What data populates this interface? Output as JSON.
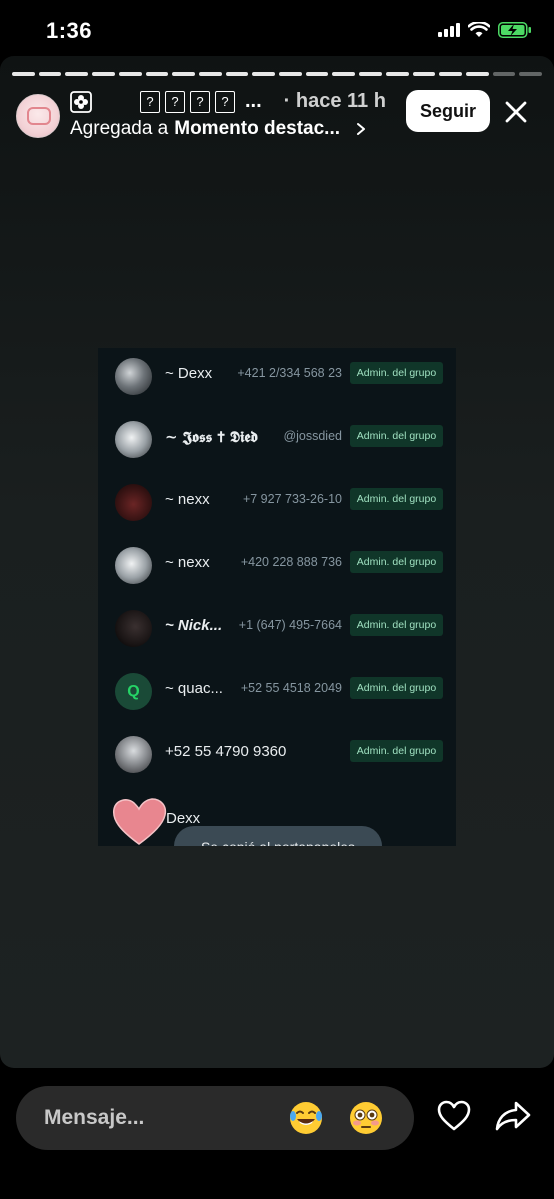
{
  "status_bar": {
    "time": "1:36",
    "icons": [
      "signal-icon",
      "wifi-icon",
      "battery-charging-icon"
    ]
  },
  "story": {
    "progress_segments": 20,
    "progress_filled": 18,
    "header": {
      "username_suffix": "...",
      "time_ago": "· hace 11 h",
      "added_prefix": "Agregada a",
      "highlight_name": "Momento destac...",
      "follow_label": "Seguir"
    },
    "screenshot": {
      "members": [
        {
          "name": "~ Dexx",
          "phone": "+421 2/334 568 23",
          "badge": "Admin. del grupo"
        },
        {
          "name": "~ 𝕵𝖔𝖘𝖘 ✝ 𝕯𝖎𝖊𝖉",
          "phone": "@jossdied",
          "badge": "Admin. del grupo"
        },
        {
          "name": "~ nexx",
          "phone": "+7 927 733-26-10",
          "badge": "Admin. del grupo"
        },
        {
          "name": "~ nexx",
          "phone": "+420 228 888 736",
          "badge": "Admin. del grupo"
        },
        {
          "name": "~ Nick...",
          "phone": "+1 (647) 495-7664",
          "badge": "Admin. del grupo"
        },
        {
          "name": "~ quac...",
          "phone": "+52 55 4518 2049",
          "badge": "Admin. del grupo",
          "avatar_letter": "Q"
        },
        {
          "name": "+52 55 4790 9360",
          "phone": "",
          "badge": "Admin. del grupo"
        }
      ],
      "last_name": "Dexx",
      "toast": "Se copió al portapapeles"
    }
  },
  "bottom_bar": {
    "message_placeholder": "Mensaje...",
    "emoji_1": "😂",
    "emoji_2": "😳"
  }
}
